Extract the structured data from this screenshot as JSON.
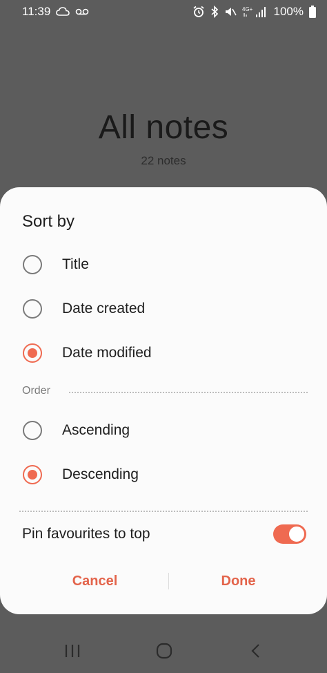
{
  "status_bar": {
    "time": "11:39",
    "battery": "100%",
    "network_label": "4G+",
    "icons": [
      "cloud-sync-icon",
      "voicemail-icon",
      "alarm-icon",
      "bluetooth-icon",
      "mute-icon",
      "signal-icon",
      "battery-icon"
    ]
  },
  "background": {
    "title": "All notes",
    "subtitle": "22 notes"
  },
  "dialog": {
    "title": "Sort by",
    "sort_options": [
      {
        "label": "Title",
        "selected": false
      },
      {
        "label": "Date created",
        "selected": false
      },
      {
        "label": "Date modified",
        "selected": true
      }
    ],
    "order_label": "Order",
    "order_options": [
      {
        "label": "Ascending",
        "selected": false
      },
      {
        "label": "Descending",
        "selected": true
      }
    ],
    "pin_favourites_label": "Pin favourites to top",
    "pin_favourites_on": true,
    "cancel_label": "Cancel",
    "done_label": "Done"
  },
  "colors": {
    "accent": "#ef6a51",
    "overlay": "#5c5c5c",
    "dialog_bg": "#fbfbfb"
  },
  "nav_bar": {
    "icons": [
      "recents-icon",
      "home-icon",
      "back-icon"
    ]
  }
}
